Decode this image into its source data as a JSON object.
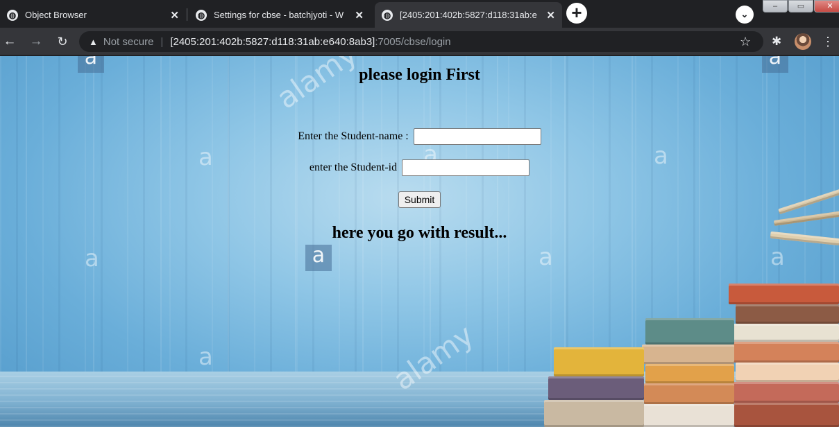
{
  "browser": {
    "tabs": [
      {
        "title": "Object Browser",
        "active": false
      },
      {
        "title": "Settings for cbse - batchjyoti - W",
        "active": false
      },
      {
        "title": "[2405:201:402b:5827:d118:31ab:e",
        "active": true
      }
    ],
    "address": {
      "warning": "Not secure",
      "host": "[2405:201:402b:5827:d118:31ab:e640:8ab3]",
      "path": ":7005/cbse/login"
    }
  },
  "page": {
    "heading": "please login First",
    "name_label": "Enter the Student-name :",
    "name_value": "",
    "id_label": "enter the Student-id",
    "id_value": "",
    "submit_label": "Submit",
    "result_heading": "here you go with result..."
  },
  "background": {
    "watermarks": [
      "a",
      "alamy",
      "a",
      "a",
      "a",
      "a",
      "a",
      "a",
      "a",
      "a",
      "a",
      "alamy",
      "a"
    ]
  }
}
